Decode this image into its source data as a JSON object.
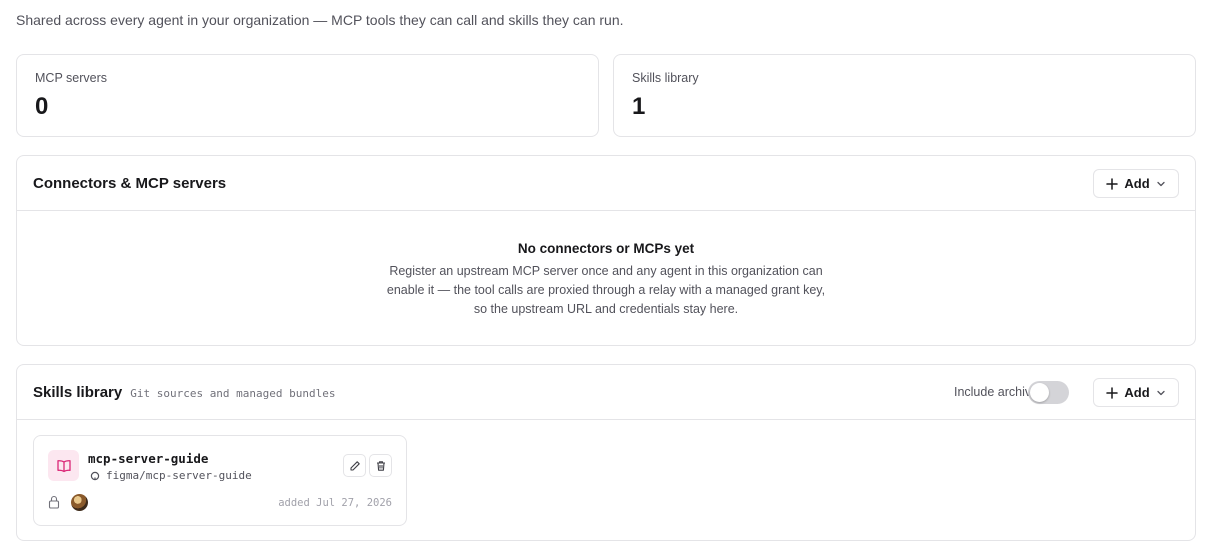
{
  "page": {
    "subtitle": "Shared across every agent in your organization — MCP tools they can call and skills they can run."
  },
  "stats": [
    {
      "label": "MCP servers",
      "value": "0"
    },
    {
      "label": "Skills library",
      "value": "1"
    }
  ],
  "connectors": {
    "title": "Connectors & MCP servers",
    "add_label": "Add",
    "empty_title": "No connectors or MCPs yet",
    "empty_body": "Register an upstream MCP server once and any agent in this organization can enable it — the tool calls are proxied through a relay with a managed grant key, so the upstream URL and credentials stay here."
  },
  "skills": {
    "title": "Skills library",
    "description": "Git sources and managed bundles",
    "include_archived_label": "Include archived",
    "include_archived": false,
    "add_label": "Add",
    "items": [
      {
        "name": "mcp-server-guide",
        "source": "figma/mcp-server-guide",
        "added": "added Jul 27, 2026"
      }
    ]
  },
  "colors": {
    "skill_icon_bg": "#fce7f0",
    "skill_icon": "#db2777",
    "border": "#e4e4e7"
  }
}
